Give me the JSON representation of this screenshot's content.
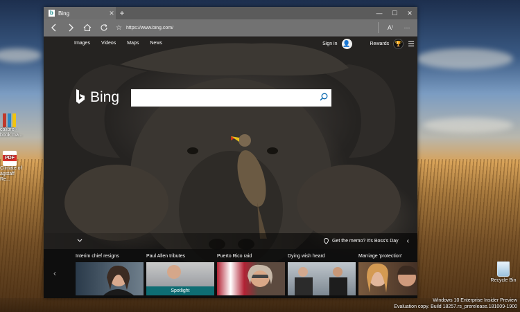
{
  "desktop": {
    "icons": [
      {
        "label": "calibre - book ma..."
      },
      {
        "label": "Climate of agstaff Re..."
      }
    ],
    "pdf_badge": "PDF",
    "recycle_bin": "Recycle Bin",
    "watermark": {
      "line1": "Windows 10 Enterprise Insider Preview",
      "line2": "Evaluation copy. Build 18257.rs_prerelease.181009-1900"
    }
  },
  "browser": {
    "tab": {
      "title": "Bing",
      "icon": "bing-favicon"
    },
    "new_tab": "+",
    "window_controls": {
      "minimize": "—",
      "maximize": "☐",
      "close": "✕"
    },
    "address_url": "https://www.bing.com/",
    "colors": {
      "tabbar": "#5b5b5b",
      "navbar": "#727272",
      "favicon": "#0c8484"
    }
  },
  "bing": {
    "top_links": [
      "Images",
      "Videos",
      "Maps",
      "News"
    ],
    "sign_in": "Sign in",
    "rewards": "Rewards",
    "logo_text": "Bing",
    "search_placeholder": "",
    "memo": "Get the memo? It's Boss's Day",
    "news": [
      {
        "title": "Interim chief resigns"
      },
      {
        "title": "Paul Allen tributes",
        "badge": "Spotlight"
      },
      {
        "title": "Puerto Rico raid"
      },
      {
        "title": "Dying wish heard"
      },
      {
        "title": "Marriage 'protection'"
      }
    ],
    "colors": {
      "accent": "#0c6ab0",
      "spotlight": "#0e6d73"
    }
  }
}
